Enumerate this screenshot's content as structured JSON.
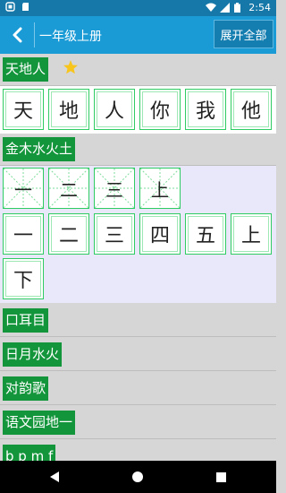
{
  "status": {
    "time": "2:54"
  },
  "appbar": {
    "title": "一年级上册",
    "expand_label": "展开全部"
  },
  "sections": [
    {
      "title": "天地人",
      "starred": true,
      "characters": [
        "天",
        "地",
        "人",
        "你",
        "我",
        "他"
      ]
    },
    {
      "title": "金木水火土",
      "practice": [
        "一",
        "二",
        "三",
        "上"
      ],
      "characters": [
        "一",
        "二",
        "三",
        "四",
        "五",
        "上",
        "下"
      ]
    },
    {
      "title": "口耳目"
    },
    {
      "title": "日月水火"
    },
    {
      "title": "对韵歌"
    },
    {
      "title": "语文园地一"
    },
    {
      "title": "b p m f"
    }
  ],
  "colors": {
    "appbar": "#1a9bd6",
    "statusbar": "#1678a8",
    "tag": "#13953b",
    "grid_border": "#2ecc63",
    "star": "#f7c51b"
  }
}
